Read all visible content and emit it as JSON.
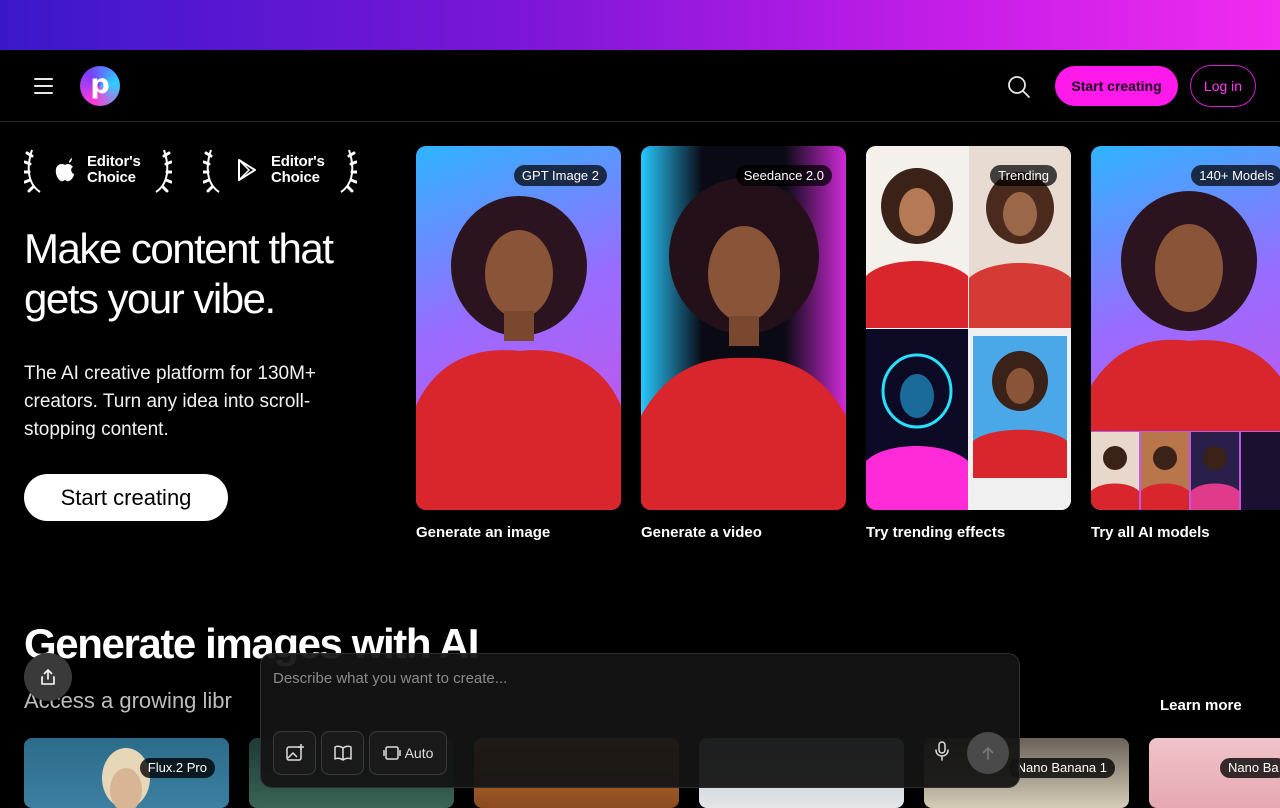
{
  "brand": {
    "logo_letter": "p",
    "accent": "#ff19ea"
  },
  "nav": {
    "menu_icon": "hamburger-icon",
    "search_icon": "search-icon",
    "start_label": "Start creating",
    "login_label": "Log in"
  },
  "awards": [
    {
      "platform": "apple-icon",
      "line1": "Editor's",
      "line2": "Choice"
    },
    {
      "platform": "google-play-icon",
      "line1": "Editor's",
      "line2": "Choice"
    }
  ],
  "hero": {
    "title": "Make content that gets your vibe.",
    "subtitle": "The AI creative platform for 130M+ creators. Turn any idea into scroll-stopping content.",
    "cta": "Start creating"
  },
  "cards": [
    {
      "badge": "GPT Image 2",
      "label": "Generate an image"
    },
    {
      "badge": "Seedance 2.0",
      "label": "Generate a video"
    },
    {
      "badge": "Trending",
      "label": "Try trending effects"
    },
    {
      "badge": "140+ Models",
      "label": "Try all AI models"
    }
  ],
  "section": {
    "title": "Generate images with AI",
    "subtitle": "Access a growing libr",
    "learn_more": "Learn more"
  },
  "thumbs": [
    {
      "badge": "Flux.2 Pro"
    },
    {
      "badge": ""
    },
    {
      "badge": ""
    },
    {
      "badge": ""
    },
    {
      "badge": "Nano Banana 1"
    },
    {
      "badge": "Nano Ba"
    }
  ],
  "prompt": {
    "placeholder": "Describe what you want to create...",
    "aspect_label": "Auto"
  }
}
